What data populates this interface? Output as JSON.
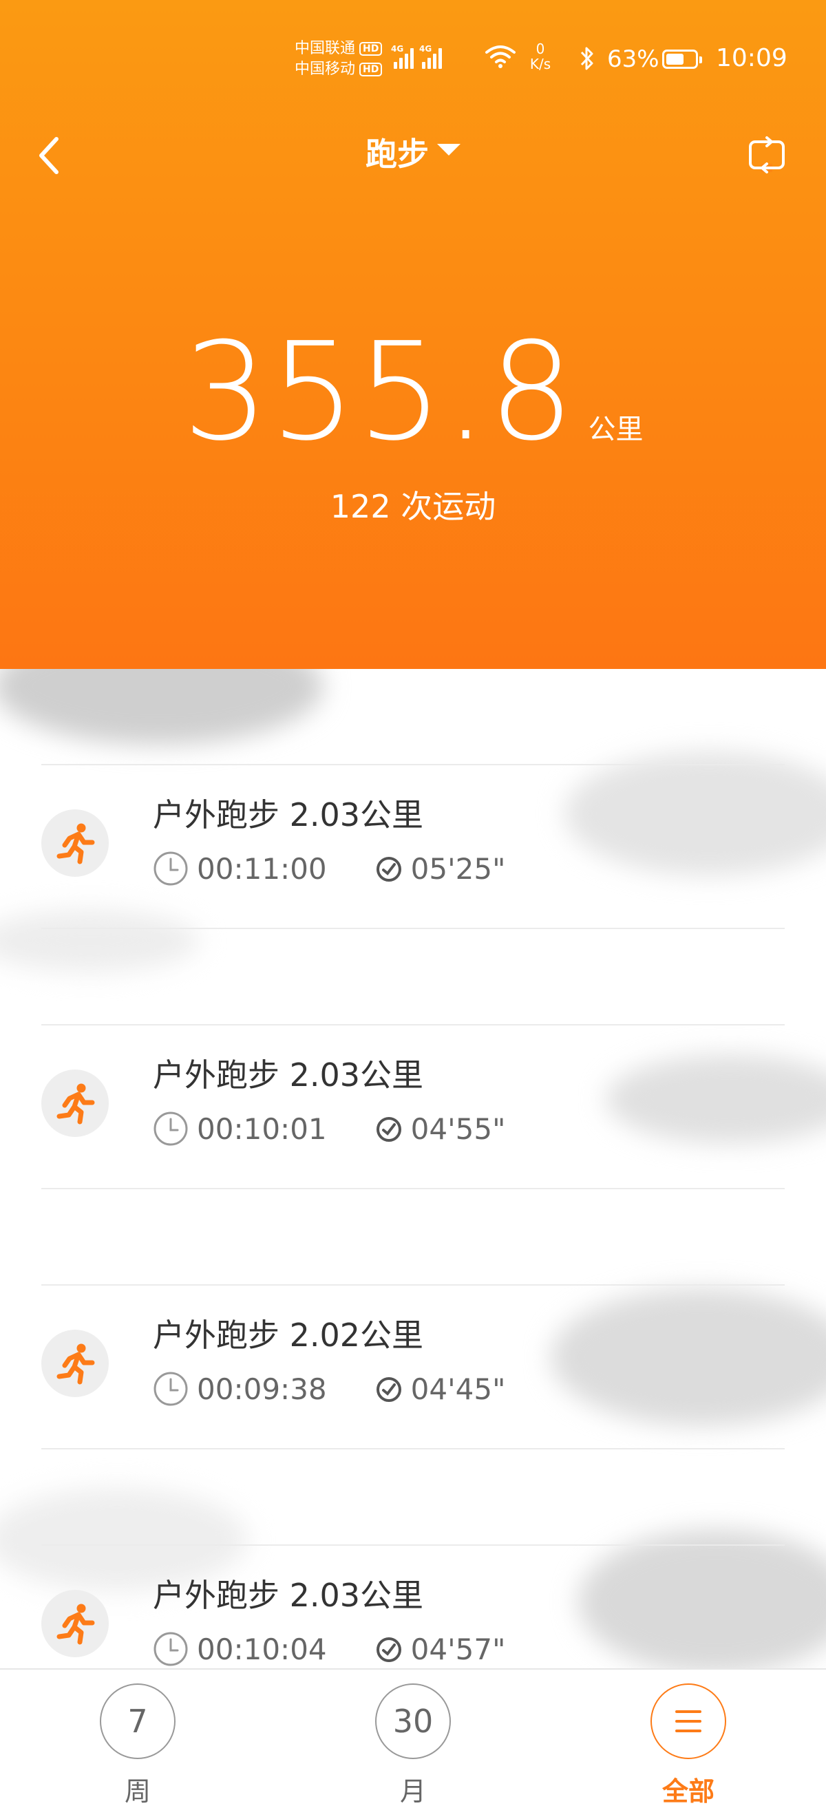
{
  "status_bar": {
    "carrier1": "中国联通",
    "carrier2": "中国移动",
    "hd": "HD",
    "network1": "4G",
    "network2": "4G",
    "speed_value": "0",
    "speed_unit": "K/s",
    "battery": "63%",
    "battery_level": 0.63,
    "time": "10:09"
  },
  "nav": {
    "title": "跑步",
    "back_icon": "chevron-left-icon",
    "switch_icon": "repeat-icon"
  },
  "summary": {
    "total_distance": "355.8",
    "unit": "公里",
    "count_text": "122 次运动"
  },
  "records": [
    {
      "title": "户外跑步 2.03公里",
      "duration": "00:11:00",
      "pace": "05'25\""
    },
    {
      "title": "户外跑步 2.03公里",
      "duration": "00:10:01",
      "pace": "04'55\""
    },
    {
      "title": "户外跑步 2.02公里",
      "duration": "00:09:38",
      "pace": "04'45\""
    },
    {
      "title": "户外跑步 2.03公里",
      "duration": "00:10:04",
      "pace": "04'57\""
    }
  ],
  "tabs": [
    {
      "value": "7",
      "label": "周"
    },
    {
      "value": "30",
      "label": "月"
    },
    {
      "value": "☰",
      "label": "全部"
    }
  ],
  "colors": {
    "accent": "#fd7b17",
    "header_top": "#fb9a12",
    "header_bottom": "#fd7613"
  }
}
